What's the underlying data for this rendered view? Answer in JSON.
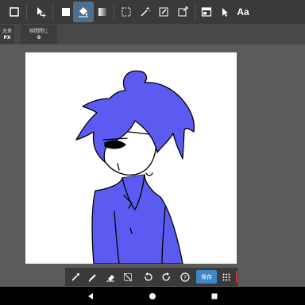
{
  "toolbar": {
    "items": [
      {
        "name": "rectangle-select-icon"
      },
      {
        "name": "move-tool-icon"
      },
      {
        "name": "fill-square-icon"
      },
      {
        "name": "paint-bucket-icon"
      },
      {
        "name": "gradient-icon"
      },
      {
        "name": "marquee-select-icon"
      },
      {
        "name": "magic-wand-icon"
      },
      {
        "name": "pen-select-icon"
      },
      {
        "name": "transform-icon"
      },
      {
        "name": "layers-panel-icon"
      },
      {
        "name": "pointer-icon"
      }
    ],
    "text_tool_label": "Aa"
  },
  "options": {
    "left": {
      "label": "允差",
      "value": "PX"
    },
    "gap": {
      "label": "隙間閉じ",
      "value": "0"
    }
  },
  "bottom_tools": [
    {
      "name": "eyedropper-icon"
    },
    {
      "name": "pen-icon"
    },
    {
      "name": "eraser-icon"
    },
    {
      "name": "deselect-icon"
    },
    {
      "name": "undo-icon"
    },
    {
      "name": "redo-icon"
    },
    {
      "name": "help-icon"
    }
  ],
  "save_label": "保存",
  "colors": {
    "fill": "#5b5bf2",
    "toolbar_bg": "#3a3a3a",
    "active": "#4f6f8f",
    "save": "#3d87c8"
  }
}
